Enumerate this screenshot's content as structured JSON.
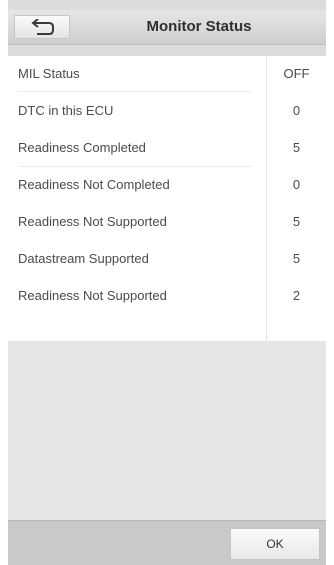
{
  "header": {
    "title": "Monitor Status",
    "back_icon": "back-arrow-icon"
  },
  "rows": [
    {
      "label": "MIL Status",
      "value": "OFF"
    },
    {
      "label": "DTC in this ECU",
      "value": "0"
    },
    {
      "label": "Readiness Completed",
      "value": "5"
    },
    {
      "label": "Readiness Not Completed",
      "value": "0"
    },
    {
      "label": "Readiness Not Supported",
      "value": "5"
    },
    {
      "label": "Datastream Supported",
      "value": "5"
    },
    {
      "label": "Readiness Not Supported",
      "value": "2"
    }
  ],
  "footer": {
    "ok_label": "OK"
  }
}
